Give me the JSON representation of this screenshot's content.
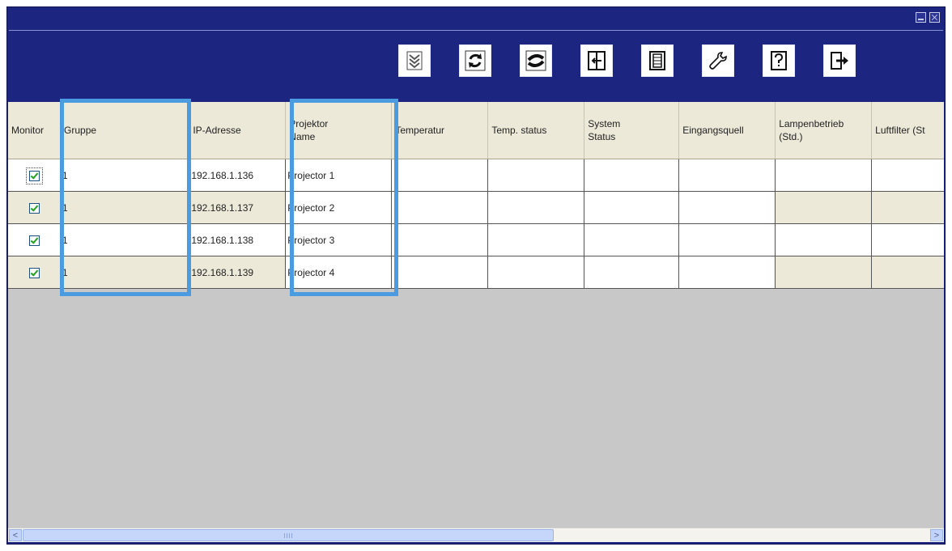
{
  "window": {
    "title": "",
    "controls": [
      "minimize-icon",
      "close-icon"
    ]
  },
  "toolbar": {
    "buttons": [
      {
        "name": "expand-button",
        "icon": "double-chevron-down-icon"
      },
      {
        "name": "refresh-button",
        "icon": "refresh-icon"
      },
      {
        "name": "reconnect-button",
        "icon": "reconnect-arrows-icon"
      },
      {
        "name": "import-button",
        "icon": "import-icon"
      },
      {
        "name": "save-button",
        "icon": "save-icon"
      },
      {
        "name": "settings-button",
        "icon": "wrench-icon"
      },
      {
        "name": "help-button",
        "icon": "help-icon"
      },
      {
        "name": "exit-button",
        "icon": "exit-icon"
      }
    ]
  },
  "table": {
    "columns": [
      "Monitor",
      "Gruppe",
      "IP-Adresse",
      "Projektor\nName",
      "Temperatur",
      "Temp. status",
      "System\nStatus",
      "Eingangsquell",
      "Lampenbetrieb\n(Std.)",
      "Luftfilter (St"
    ],
    "rows": [
      {
        "monitor": true,
        "group": "1",
        "ip": "192.168.1.136",
        "name": "Projector 1"
      },
      {
        "monitor": true,
        "group": "1",
        "ip": "192.168.1.137",
        "name": "Projector 2"
      },
      {
        "monitor": true,
        "group": "1",
        "ip": "192.168.1.138",
        "name": "Projector 3"
      },
      {
        "monitor": true,
        "group": "1",
        "ip": "192.168.1.139",
        "name": "Projector 4"
      }
    ]
  },
  "highlights": [
    "Gruppe",
    "Projektor Name"
  ],
  "colors": {
    "frame": "#1c2580",
    "header": "#ece9d8",
    "highlight": "#4a9be0",
    "empty_area": "#c8c8c8"
  },
  "scrollbar": {
    "left_arrow": "<",
    "right_arrow": ">"
  }
}
